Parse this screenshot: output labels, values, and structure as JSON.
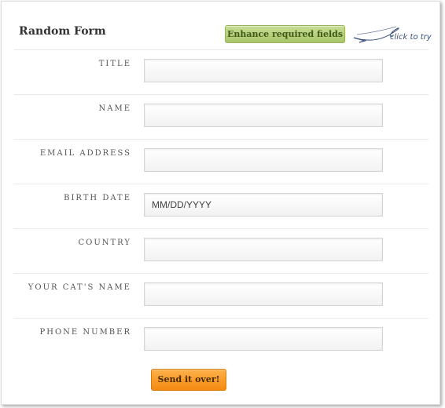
{
  "form": {
    "title": "Random Form",
    "enhance_button_label": "Enhance required fields",
    "hint_text": "click to try",
    "fields": [
      {
        "label": "TITLE",
        "value": "",
        "placeholder": ""
      },
      {
        "label": "NAME",
        "value": "",
        "placeholder": ""
      },
      {
        "label": "EMAIL ADDRESS",
        "value": "",
        "placeholder": ""
      },
      {
        "label": "BIRTH DATE",
        "value": "",
        "placeholder": "MM/DD/YYYY"
      },
      {
        "label": "COUNTRY",
        "value": "",
        "placeholder": ""
      },
      {
        "label": "YOUR CAT'S NAME",
        "value": "",
        "placeholder": ""
      },
      {
        "label": "PHONE NUMBER",
        "value": "",
        "placeholder": ""
      }
    ],
    "submit_label": "Send it over!"
  },
  "colors": {
    "enhance_button": "#b5d07c",
    "submit_button": "#f7981c",
    "hint_arrow": "#3a4f7a"
  },
  "icons": {
    "hint_arrow": "hand-drawn-arrow-icon"
  }
}
